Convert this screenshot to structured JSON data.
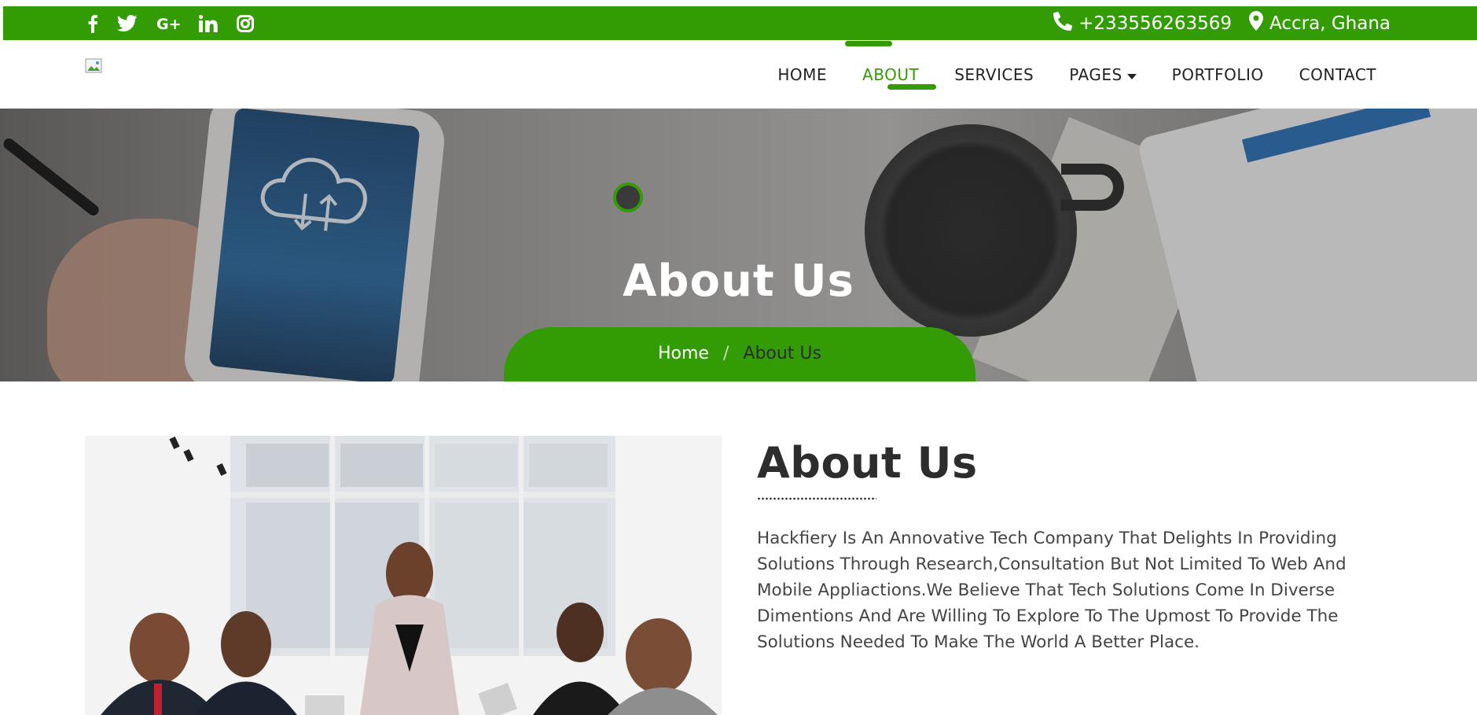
{
  "colors": {
    "brand_green": "#339c05",
    "text_dark": "#2d2d2d"
  },
  "topbar": {
    "social_icons": [
      "facebook-icon",
      "twitter-icon",
      "google-plus-icon",
      "linkedin-icon",
      "instagram-icon"
    ],
    "social_glyphs": {
      "facebook": "f",
      "twitter": "t",
      "google_plus": "G+",
      "linkedin": "in",
      "instagram": "ig"
    },
    "phone": "+233556263569",
    "location": "Accra, Ghana"
  },
  "nav": {
    "items": [
      {
        "label": "HOME"
      },
      {
        "label": "ABOUT",
        "active": true
      },
      {
        "label": "SERVICES"
      },
      {
        "label": "PAGES",
        "has_dropdown": true
      },
      {
        "label": "PORTFOLIO"
      },
      {
        "label": "CONTACT"
      }
    ]
  },
  "hero": {
    "title": "About Us",
    "breadcrumb": {
      "home": "Home",
      "separator": "/",
      "current": "About Us"
    }
  },
  "about": {
    "heading": "About Us",
    "text": "Hackfiery Is An Annovative Tech Company That Delights In Providing Solutions Through Research,Consultation But Not Limited To Web And Mobile Appliactions.We Believe That Tech Solutions Come In Diverse Dimentions And Are Willing To Explore To The Upmost To Provide The Solutions Needed To Make The World A Better Place."
  }
}
